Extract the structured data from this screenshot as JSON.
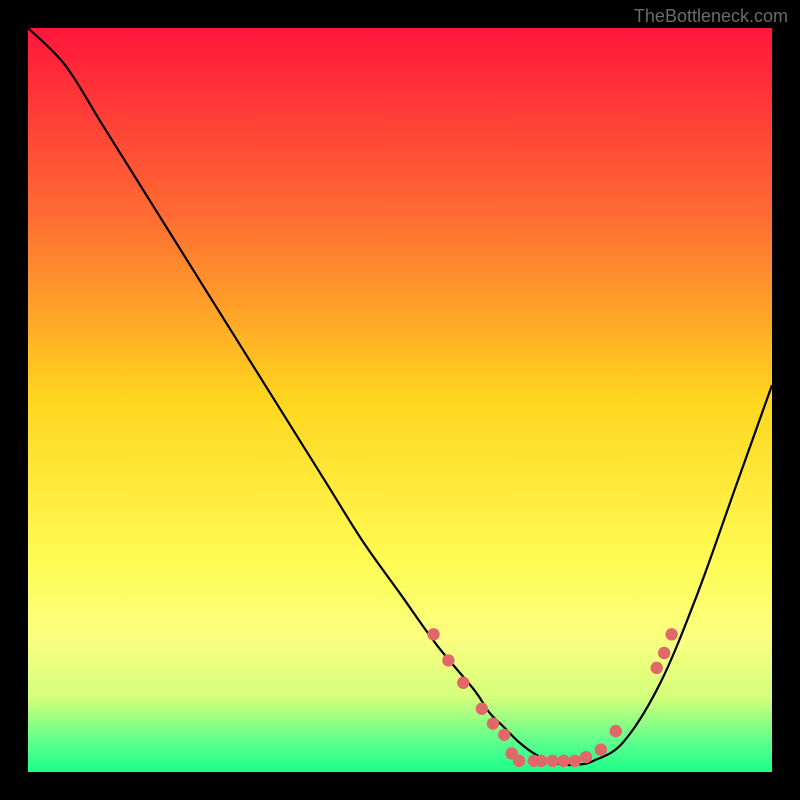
{
  "watermark": "TheBottleneck.com",
  "chart_data": {
    "type": "line",
    "title": "",
    "xlabel": "",
    "ylabel": "",
    "xlim": [
      0,
      100
    ],
    "ylim": [
      0,
      100
    ],
    "series": [
      {
        "name": "curve",
        "x": [
          0,
          5,
          10,
          15,
          20,
          25,
          30,
          35,
          40,
          45,
          50,
          55,
          60,
          62,
          64,
          66,
          68,
          70,
          72,
          74,
          76,
          80,
          85,
          90,
          95,
          100
        ],
        "y": [
          100,
          95,
          87,
          79,
          71,
          63,
          55,
          47,
          39,
          31,
          24,
          17,
          11,
          8,
          6,
          4,
          2.5,
          1.5,
          1,
          1,
          1.5,
          4,
          12,
          24,
          38,
          52
        ]
      }
    ],
    "markers": [
      {
        "x": 54.5,
        "y": 18.5
      },
      {
        "x": 56.5,
        "y": 15
      },
      {
        "x": 58.5,
        "y": 12
      },
      {
        "x": 61,
        "y": 8.5
      },
      {
        "x": 62.5,
        "y": 6.5
      },
      {
        "x": 64,
        "y": 5
      },
      {
        "x": 65,
        "y": 2.5
      },
      {
        "x": 66,
        "y": 1.5
      },
      {
        "x": 68,
        "y": 1.5
      },
      {
        "x": 69,
        "y": 1.5
      },
      {
        "x": 70.5,
        "y": 1.5
      },
      {
        "x": 72,
        "y": 1.5
      },
      {
        "x": 73.5,
        "y": 1.5
      },
      {
        "x": 75,
        "y": 2
      },
      {
        "x": 77,
        "y": 3
      },
      {
        "x": 79,
        "y": 5.5
      },
      {
        "x": 84.5,
        "y": 14
      },
      {
        "x": 85.5,
        "y": 16
      },
      {
        "x": 86.5,
        "y": 18.5
      }
    ],
    "gradient_stops": [
      {
        "offset": 0,
        "color": "#ff163b"
      },
      {
        "offset": 25,
        "color": "#ff6b33"
      },
      {
        "offset": 50,
        "color": "#ffd61f"
      },
      {
        "offset": 72,
        "color": "#fffc55"
      },
      {
        "offset": 82,
        "color": "#faff80"
      },
      {
        "offset": 90,
        "color": "#d4ff7a"
      },
      {
        "offset": 96,
        "color": "#5cff8c"
      },
      {
        "offset": 100,
        "color": "#1cff8a"
      }
    ],
    "marker_color": "#e06868",
    "curve_color": "#000000"
  }
}
